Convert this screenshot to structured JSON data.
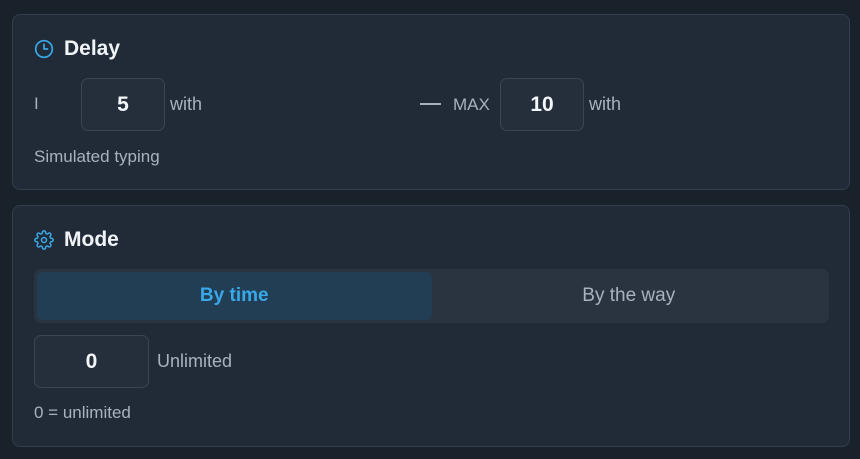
{
  "delay": {
    "title": "Delay",
    "icon": "clock-icon",
    "prefix": "I",
    "min_value": "5",
    "min_unit": "with",
    "max_label": "MAX",
    "max_value": "10",
    "max_unit": "with",
    "hint": "Simulated typing"
  },
  "mode": {
    "title": "Mode",
    "icon": "gear-icon",
    "options": [
      {
        "label": "By time",
        "active": true
      },
      {
        "label": "By the way",
        "active": false
      }
    ],
    "limit_value": "0",
    "limit_label": "Unlimited",
    "hint": "0 = unlimited"
  },
  "colors": {
    "accent": "#38a8e8",
    "card_bg": "#212b37",
    "page_bg": "#19212b"
  }
}
